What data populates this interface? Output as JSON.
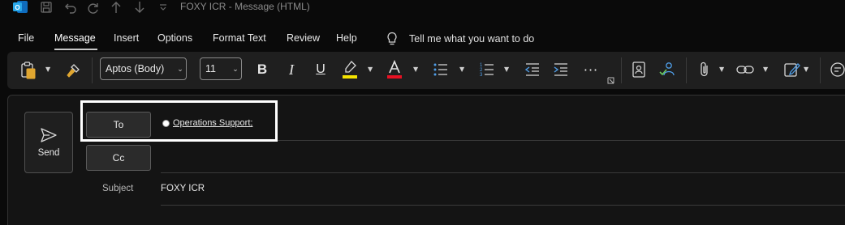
{
  "window": {
    "title": "FOXY ICR  -  Message (HTML)",
    "app_icon": "outlook-icon",
    "quick_access_icons": [
      "save-icon",
      "undo-icon",
      "redo-icon",
      "previous-item-icon",
      "next-item-icon",
      "customize-quick-access-icon"
    ]
  },
  "menu": {
    "items": [
      "File",
      "Message",
      "Insert",
      "Options",
      "Format Text",
      "Review",
      "Help"
    ],
    "active": "Message",
    "tell_me": "Tell me what you want to do"
  },
  "ribbon": {
    "font_name": "Aptos (Body)",
    "font_size": "11",
    "highlight_color": "#f5e400",
    "font_color": "#e81123",
    "icons": [
      "paste-icon",
      "format-painter-icon",
      "bold-icon",
      "italic-icon",
      "underline-icon",
      "highlight-icon",
      "font-color-icon",
      "bullets-icon",
      "numbering-icon",
      "decrease-indent-icon",
      "increase-indent-icon",
      "more-icon",
      "dialog-launcher-icon",
      "address-book-icon",
      "check-names-icon",
      "attach-file-icon",
      "link-icon",
      "signature-icon",
      "more-ribbon-icon"
    ]
  },
  "compose": {
    "send_label": "Send",
    "to_label": "To",
    "cc_label": "Cc",
    "subject_label": "Subject",
    "subject_value": "FOXY ICR",
    "recipients": [
      {
        "name": "Operations Support;",
        "presence_color": "#ffffff"
      }
    ]
  },
  "accent_color": "#0f6cbd"
}
